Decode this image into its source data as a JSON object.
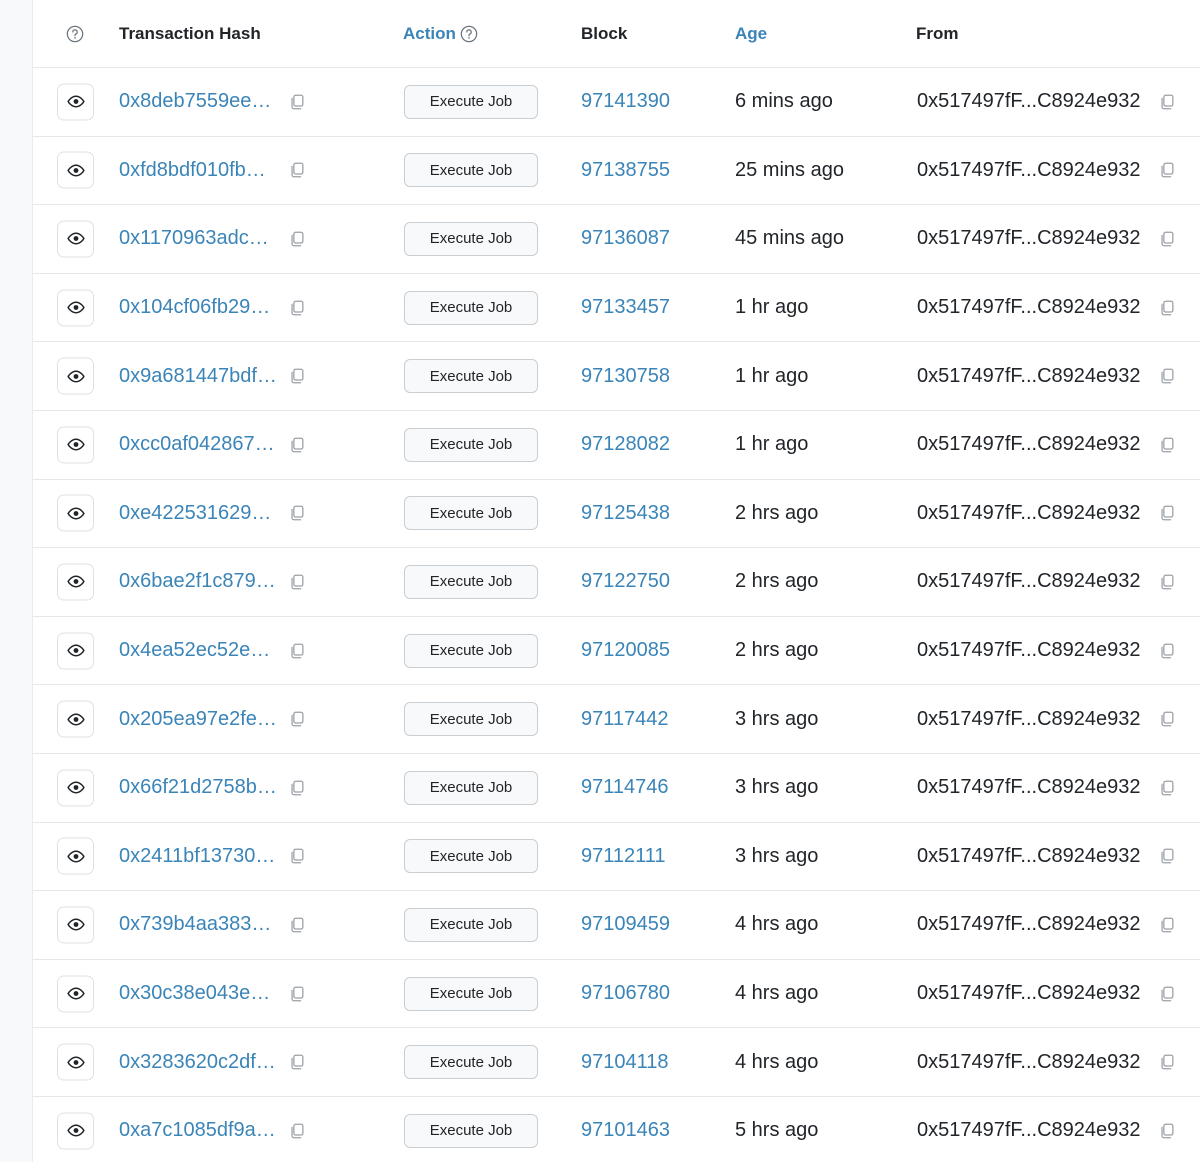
{
  "header": {
    "transaction_hash": "Transaction Hash",
    "action": "Action",
    "block": "Block",
    "age": "Age",
    "from": "From"
  },
  "colors": {
    "link": "#3a84b8",
    "text": "#212529",
    "border": "#e5e7eb"
  },
  "icons": {
    "help": "question-circle-icon",
    "view": "eye-icon",
    "copy": "copy-icon"
  },
  "rows": [
    {
      "hash": "0x8deb7559ee…",
      "action": "Execute Job",
      "block": "97141390",
      "age": "6 mins ago",
      "from": "0x517497fF...C8924e932"
    },
    {
      "hash": "0xfd8bdf010fb…",
      "action": "Execute Job",
      "block": "97138755",
      "age": "25 mins ago",
      "from": "0x517497fF...C8924e932"
    },
    {
      "hash": "0x1170963adc…",
      "action": "Execute Job",
      "block": "97136087",
      "age": "45 mins ago",
      "from": "0x517497fF...C8924e932"
    },
    {
      "hash": "0x104cf06fb29…",
      "action": "Execute Job",
      "block": "97133457",
      "age": "1 hr ago",
      "from": "0x517497fF...C8924e932"
    },
    {
      "hash": "0x9a681447bdf…",
      "action": "Execute Job",
      "block": "97130758",
      "age": "1 hr ago",
      "from": "0x517497fF...C8924e932"
    },
    {
      "hash": "0xcc0af042867…",
      "action": "Execute Job",
      "block": "97128082",
      "age": "1 hr ago",
      "from": "0x517497fF...C8924e932"
    },
    {
      "hash": "0xe422531629…",
      "action": "Execute Job",
      "block": "97125438",
      "age": "2 hrs ago",
      "from": "0x517497fF...C8924e932"
    },
    {
      "hash": "0x6bae2f1c879…",
      "action": "Execute Job",
      "block": "97122750",
      "age": "2 hrs ago",
      "from": "0x517497fF...C8924e932"
    },
    {
      "hash": "0x4ea52ec52e…",
      "action": "Execute Job",
      "block": "97120085",
      "age": "2 hrs ago",
      "from": "0x517497fF...C8924e932"
    },
    {
      "hash": "0x205ea97e2fe…",
      "action": "Execute Job",
      "block": "97117442",
      "age": "3 hrs ago",
      "from": "0x517497fF...C8924e932"
    },
    {
      "hash": "0x66f21d2758b…",
      "action": "Execute Job",
      "block": "97114746",
      "age": "3 hrs ago",
      "from": "0x517497fF...C8924e932"
    },
    {
      "hash": "0x2411bf13730…",
      "action": "Execute Job",
      "block": "97112111",
      "age": "3 hrs ago",
      "from": "0x517497fF...C8924e932"
    },
    {
      "hash": "0x739b4aa383…",
      "action": "Execute Job",
      "block": "97109459",
      "age": "4 hrs ago",
      "from": "0x517497fF...C8924e932"
    },
    {
      "hash": "0x30c38e043e…",
      "action": "Execute Job",
      "block": "97106780",
      "age": "4 hrs ago",
      "from": "0x517497fF...C8924e932"
    },
    {
      "hash": "0x3283620c2df…",
      "action": "Execute Job",
      "block": "97104118",
      "age": "4 hrs ago",
      "from": "0x517497fF...C8924e932"
    },
    {
      "hash": "0xa7c1085df9a…",
      "action": "Execute Job",
      "block": "97101463",
      "age": "5 hrs ago",
      "from": "0x517497fF...C8924e932"
    }
  ]
}
